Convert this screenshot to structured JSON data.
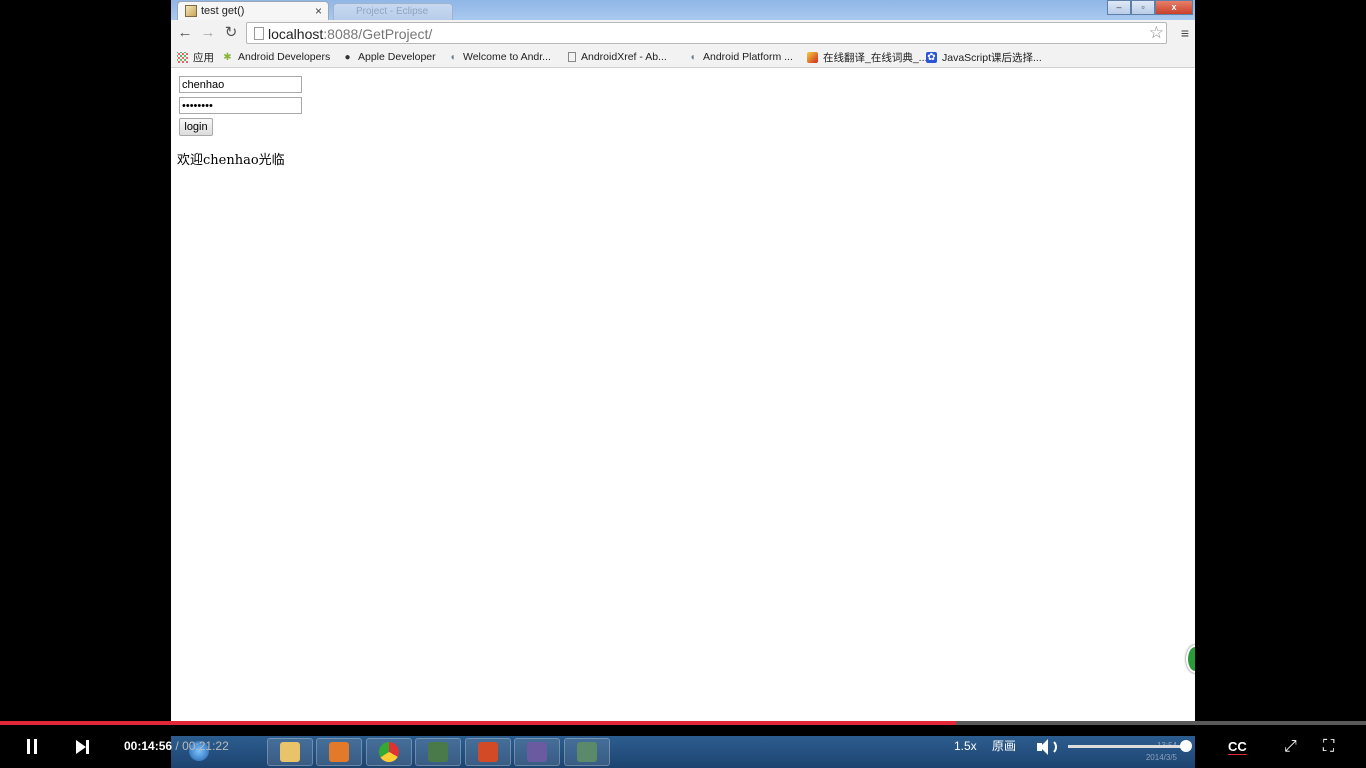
{
  "browser": {
    "tabs": [
      {
        "title": "test get()",
        "close": "×"
      },
      {
        "title": "Project - Eclipse"
      }
    ],
    "window_controls": {
      "minimize": "–",
      "restore": "▫",
      "close": "x"
    },
    "nav": {
      "back": "←",
      "forward": "→",
      "reload": "↻"
    },
    "url": {
      "host": "localhost",
      "rest": ":8088/GetProject/"
    },
    "star": "☆",
    "menu": "≡",
    "bookmarks": [
      {
        "label": "应用",
        "icon": "apps-icon"
      },
      {
        "label": "Android Developers",
        "icon": "android-icon"
      },
      {
        "label": "Apple Developer",
        "icon": "apple-icon"
      },
      {
        "label": "Welcome to Andr...",
        "icon": "android-studio-icon"
      },
      {
        "label": "AndroidXref - Ab...",
        "icon": "page-icon"
      },
      {
        "label": "Android Platform ...",
        "icon": "android-studio-icon"
      },
      {
        "label": "在线翻译_在线词典_...",
        "icon": "translate-icon"
      },
      {
        "label": "JavaScript课后选择...",
        "icon": "baidu-icon"
      }
    ]
  },
  "page": {
    "username_value": "chenhao",
    "password_value": "••••••••",
    "login_label": "login",
    "welcome_text": "欢迎chenhao光临"
  },
  "player": {
    "progress_fraction": 0.7,
    "current_time": "00:14:56",
    "separator": " / ",
    "total_time": "00:21:22",
    "speed": "1.5x",
    "quality": "原画",
    "volume_fraction": 0.98,
    "cc_label": "CC",
    "expand": "⤢",
    "fullscreen": "⛶"
  },
  "tray": {
    "time": "13:54",
    "date": "2014/3/5"
  },
  "colors": {
    "progress": "#e0283a",
    "accent_blue": "#2c5d8f"
  }
}
